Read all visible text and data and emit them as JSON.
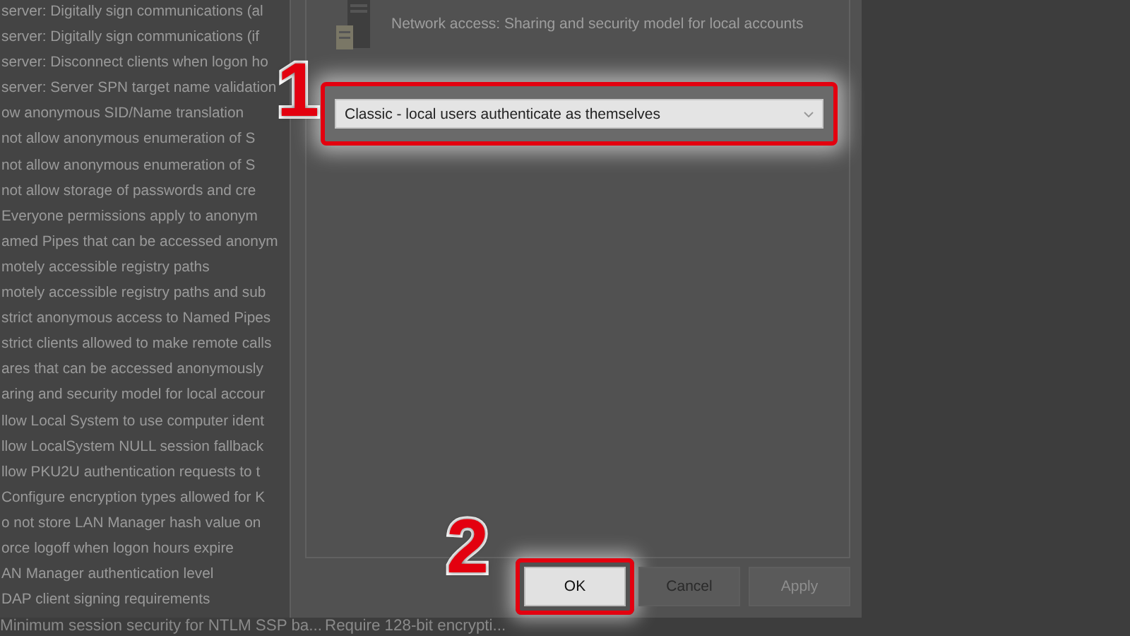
{
  "policy_list": {
    "rows": [
      "server: Digitally sign communications (al",
      "server: Digitally sign communications (if",
      "server: Disconnect clients when logon ho",
      "server: Server SPN target name validation",
      "ow anonymous SID/Name translation",
      "not allow anonymous enumeration of S",
      "not allow anonymous enumeration of S",
      "not allow storage of passwords and cre",
      "Everyone permissions apply to anonym",
      "amed Pipes that can be accessed anonym",
      "motely accessible registry paths",
      "motely accessible registry paths and sub",
      "strict anonymous access to Named Pipes",
      "strict clients allowed to make remote calls",
      "ares that can be accessed anonymously",
      "aring and security model for local accour",
      "llow Local System to use computer ident",
      "llow LocalSystem NULL session fallback",
      "llow PKU2U authentication requests to t",
      "Configure encryption types allowed for K",
      "o not store LAN Manager hash value on",
      "orce logoff when logon hours expire",
      "AN Manager authentication level",
      "DAP client signing requirements"
    ],
    "last_row": {
      "policy": "Minimum session security for NTLM SSP ba...",
      "setting": "Require 128-bit encrypti..."
    }
  },
  "dialog": {
    "heading": "Network access: Sharing and security model for local accounts",
    "dropdown": {
      "value": "Classic - local users authenticate as themselves",
      "step": "1"
    },
    "buttons": [
      {
        "label": "OK",
        "disabled": false,
        "step": "2"
      },
      {
        "label": "Cancel",
        "disabled": false
      },
      {
        "label": "Apply",
        "disabled": true
      }
    ]
  }
}
